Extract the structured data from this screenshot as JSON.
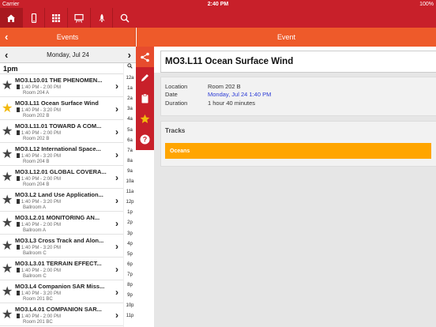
{
  "status": {
    "carrier": "Carrier",
    "time": "2:40 PM",
    "battery": "100%"
  },
  "colors": {
    "brand_red": "#c8202a",
    "header_orange": "#ee5a2a",
    "favorite_star": "#f2b90d",
    "track_chip": "#ffa500",
    "link_blue": "#2b3bd6"
  },
  "toolbar": {
    "icons": [
      "home-icon",
      "phone-icon",
      "grid-icon",
      "presentation-icon",
      "rocket-icon",
      "search-icon"
    ]
  },
  "left_header": {
    "title": "Events"
  },
  "right_header": {
    "title": "Event"
  },
  "day": {
    "label": "Monday, Jul 24"
  },
  "time_section": "1pm",
  "events": [
    {
      "title": "MO3.L10.01 THE PHENOMEN...",
      "time": "1:40 PM - 2:00 PM",
      "room": "Room 204 A",
      "favorite": false
    },
    {
      "title": "MO3.L11 Ocean Surface Wind",
      "time": "1:40 PM - 3:20 PM",
      "room": "Room 202 B",
      "favorite": true
    },
    {
      "title": "MO3.L11.01 TOWARD A COM...",
      "time": "1:40 PM - 2:00 PM",
      "room": "Room 202 B",
      "favorite": false
    },
    {
      "title": "MO3.L12 International Space...",
      "time": "1:40 PM - 3:20 PM",
      "room": "Room 204 B",
      "favorite": false
    },
    {
      "title": "MO3.L12.01 GLOBAL COVERA...",
      "time": "1:40 PM - 2:00 PM",
      "room": "Room 204 B",
      "favorite": false
    },
    {
      "title": "MO3.L2 Land Use Application...",
      "time": "1:40 PM - 3:20 PM",
      "room": "Ballroom A",
      "favorite": false
    },
    {
      "title": "MO3.L2.01 MONITORING AN...",
      "time": "1:40 PM - 2:00 PM",
      "room": "Ballroom A",
      "favorite": false
    },
    {
      "title": "MO3.L3 Cross Track and Alon...",
      "time": "1:40 PM - 3:20 PM",
      "room": "Ballroom C",
      "favorite": false
    },
    {
      "title": "MO3.L3.01 TERRAIN EFFECT...",
      "time": "1:40 PM - 2:00 PM",
      "room": "Ballroom C",
      "favorite": false
    },
    {
      "title": "MO3.L4 Companion SAR Miss...",
      "time": "1:40 PM - 3:20 PM",
      "room": "Room 201 BC",
      "favorite": false
    },
    {
      "title": "MO3.L4.01 COMPANION SAR...",
      "time": "1:40 PM - 2:00 PM",
      "room": "Room 201 BC",
      "favorite": false
    }
  ],
  "time_index": [
    "12a",
    "1a",
    "2a",
    "3a",
    "4a",
    "5a",
    "6a",
    "7a",
    "8a",
    "9a",
    "10a",
    "11a",
    "12p",
    "1p",
    "2p",
    "3p",
    "4p",
    "5p",
    "6p",
    "7p",
    "8p",
    "9p",
    "10p",
    "11p"
  ],
  "actions": [
    {
      "name": "share-icon",
      "selected": true
    },
    {
      "name": "pencil-icon",
      "selected": false
    },
    {
      "name": "clipboard-icon",
      "selected": false
    },
    {
      "name": "star-icon",
      "selected": false
    },
    {
      "name": "help-icon",
      "selected": false
    }
  ],
  "detail": {
    "title": "MO3.L11 Ocean Surface Wind",
    "location_label": "Location",
    "location": "Room 202 B",
    "date_label": "Date",
    "date": "Monday, Jul 24 1:40 PM",
    "duration_label": "Duration",
    "duration": "1 hour 40 minutes",
    "tracks_label": "Tracks",
    "tracks": [
      "Oceans"
    ]
  }
}
